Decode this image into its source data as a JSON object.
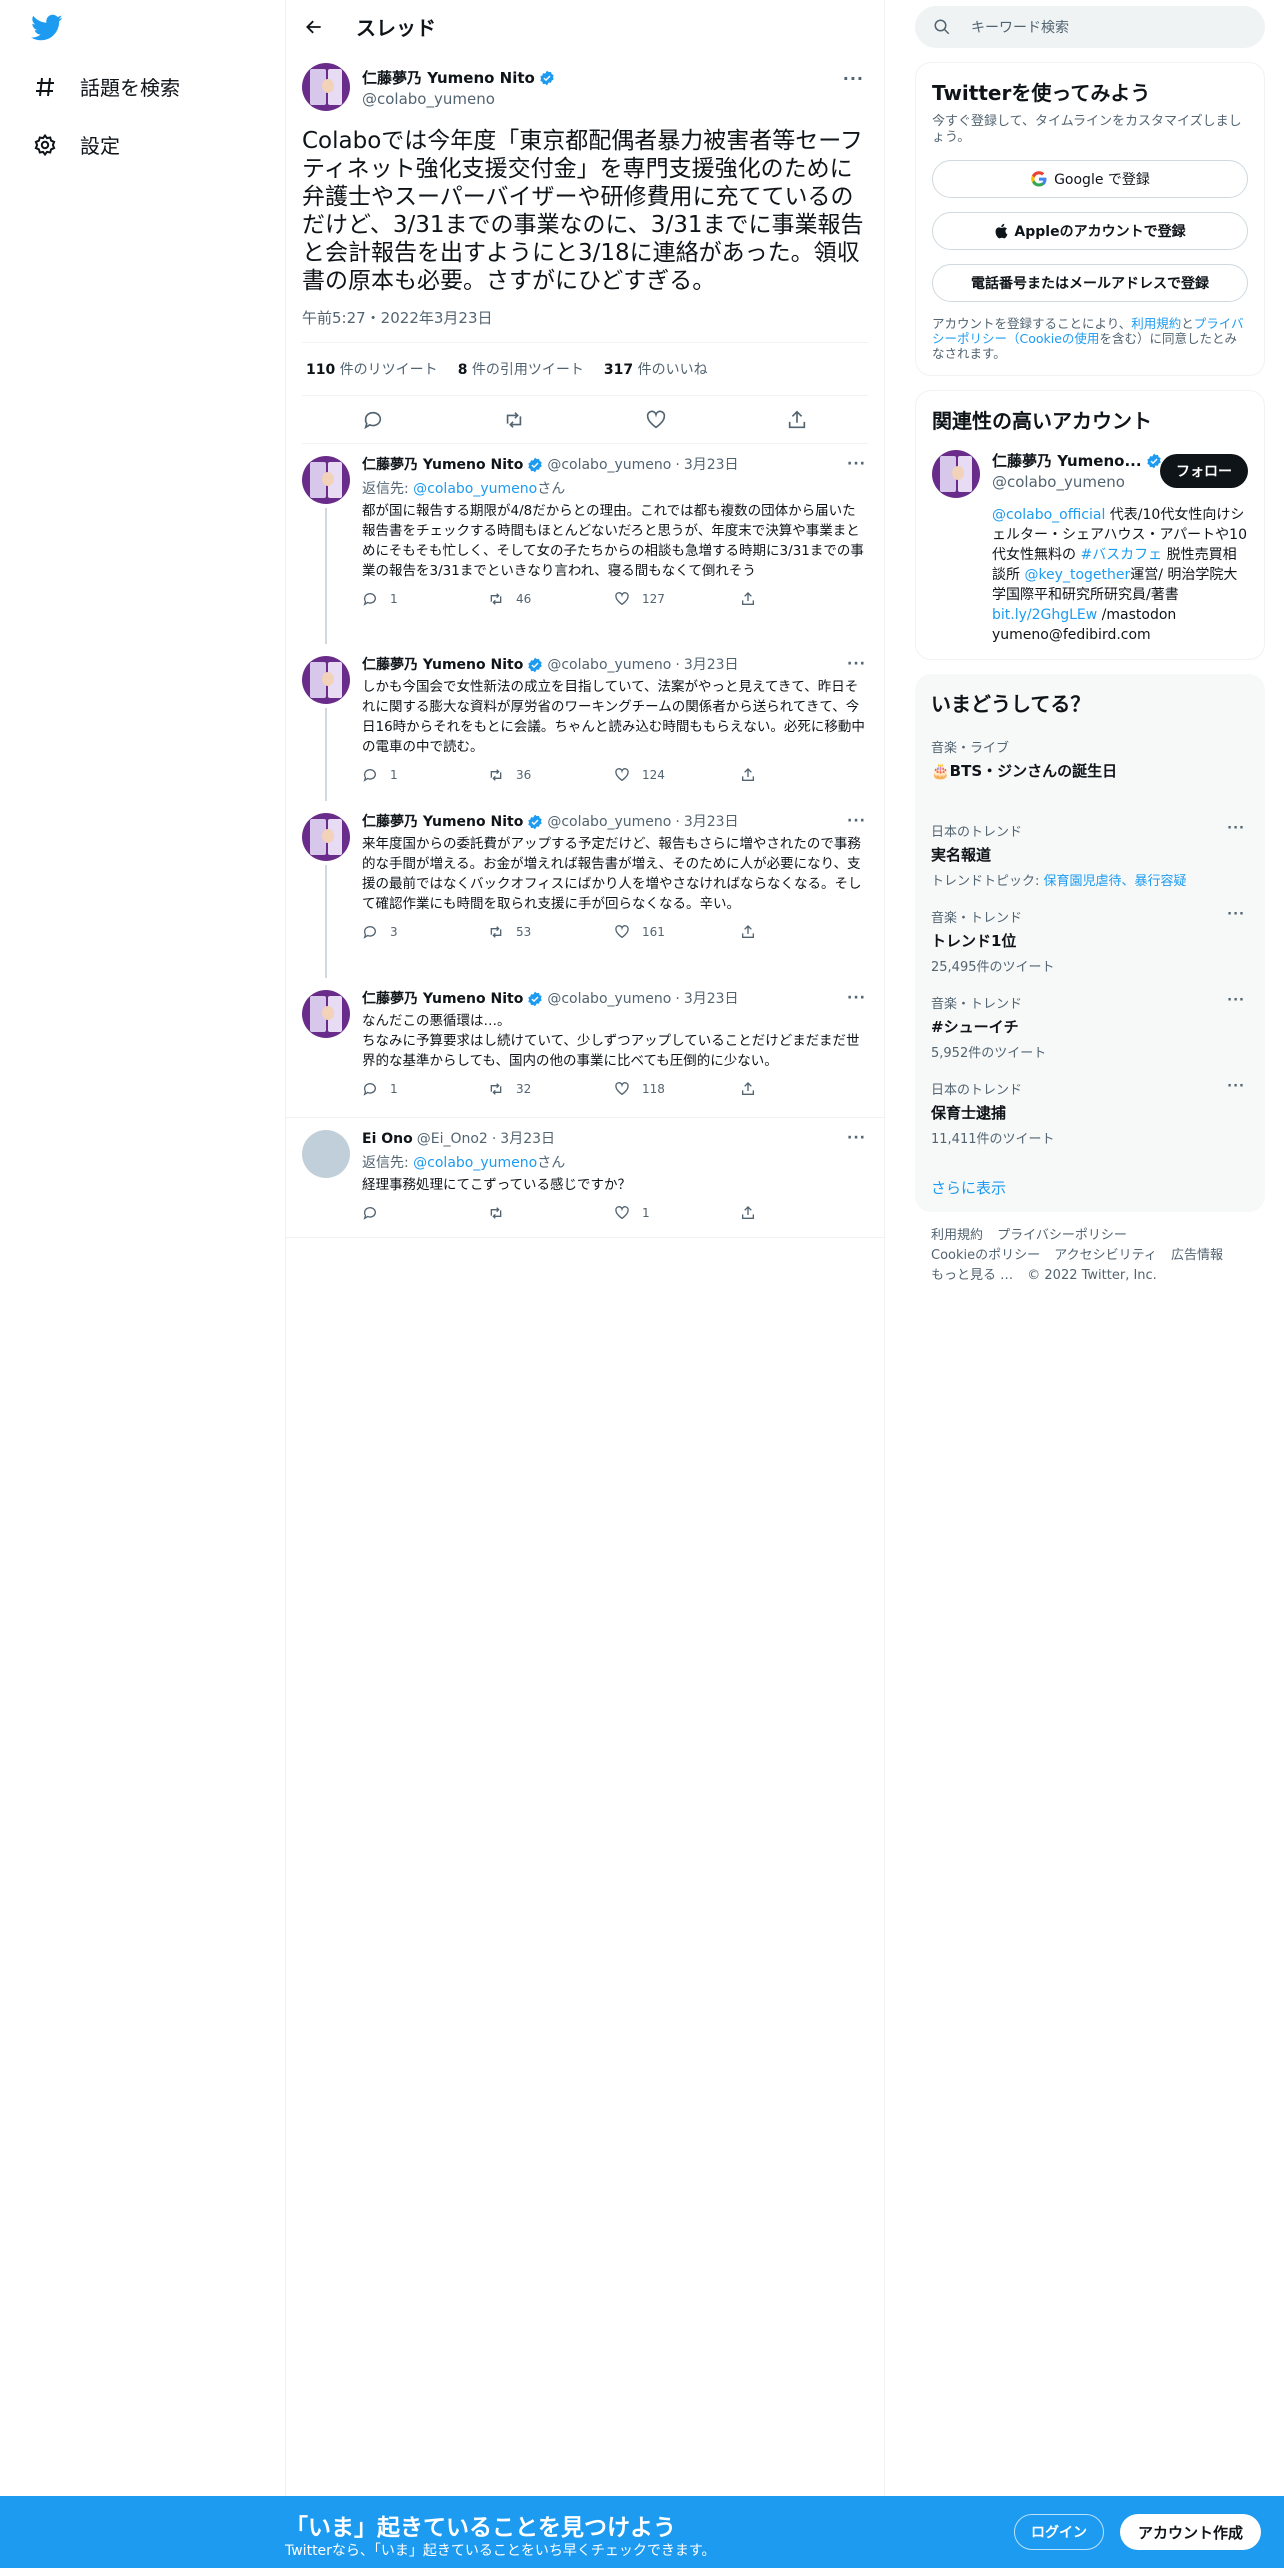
{
  "nav": {
    "items": [
      {
        "label": "話題を検索",
        "icon": "hashtag-icon"
      },
      {
        "label": "設定",
        "icon": "gear-icon"
      }
    ]
  },
  "header": {
    "title": "スレッド"
  },
  "main_tweet": {
    "name": "仁藤夢乃 Yumeno Nito",
    "handle": "@colabo_yumeno",
    "text": "Colaboでは今年度「東京都配偶者暴力被害者等セーフティネット強化支援交付金」を専門支援強化のために弁護士やスーパーバイザーや研修費用に充てているのだけど、3/31までの事業なのに、3/31までに事業報告と会計報告を出すようにと3/18に連絡があった。領収書の原本も必要。さすがにひどすぎる。",
    "time": "午前5:27・2022年3月23日",
    "retweets": "110",
    "retweets_label": "件のリツイート",
    "quotes": "8",
    "quotes_label": "件の引用ツイート",
    "likes": "317",
    "likes_label": "件のいいね"
  },
  "replies": [
    {
      "name": "仁藤夢乃 Yumeno Nito",
      "handle": "@colabo_yumeno",
      "date": "3月23日",
      "replying_prefix": "返信先: ",
      "replying_to": "@colabo_yumeno",
      "replying_suffix": "さん",
      "text": "都が国に報告する期限が4/8だからとの理由。これでは都も複数の団体から届いた報告書をチェックする時間もほとんどないだろと思うが、年度末で決算や事業まとめにそもそも忙しく、そして女の子たちからの相談も急増する時期に3/31までの事業の報告を3/31までといきなり言われ、寝る間もなくて倒れそう",
      "replies": "1",
      "retweets": "46",
      "likes": "127"
    },
    {
      "name": "仁藤夢乃 Yumeno Nito",
      "handle": "@colabo_yumeno",
      "date": "3月23日",
      "text": "しかも今国会で女性新法の成立を目指していて、法案がやっと見えてきて、昨日それに関する膨大な資料が厚労省のワーキングチームの関係者から送られてきて、今日16時からそれをもとに会議。ちゃんと読み込む時間ももらえない。必死に移動中の電車の中で読む。",
      "replies": "1",
      "retweets": "36",
      "likes": "124"
    },
    {
      "name": "仁藤夢乃 Yumeno Nito",
      "handle": "@colabo_yumeno",
      "date": "3月23日",
      "text": "来年度国からの委託費がアップする予定だけど、報告もさらに増やされたので事務的な手間が増える。お金が増えれば報告書が増え、そのために人が必要になり、支援の最前ではなくバックオフィスにばかり人を増やさなければならなくなる。そして確認作業にも時間を取られ支援に手が回らなくなる。辛い。",
      "replies": "3",
      "retweets": "53",
      "likes": "161"
    },
    {
      "name": "仁藤夢乃 Yumeno Nito",
      "handle": "@colabo_yumeno",
      "date": "3月23日",
      "text": "なんだこの悪循環は…。\nちなみに予算要求はし続けていて、少しずつアップしていることだけどまだまだ世界的な基準からしても、国内の他の事業に比べても圧倒的に少ない。",
      "replies": "1",
      "retweets": "32",
      "likes": "118"
    },
    {
      "name": "Ei Ono",
      "handle": "@Ei_Ono2",
      "date": "3月23日",
      "replying_prefix": "返信先: ",
      "replying_to": "@colabo_yumeno",
      "replying_suffix": "さん",
      "text": "経理事務処理にてこずっている感じですか？",
      "replies": "",
      "retweets": "",
      "likes": "1"
    }
  ],
  "search": {
    "placeholder": "キーワード検索"
  },
  "signup": {
    "title": "Twitterを使ってみよう",
    "subtitle": "今すぐ登録して、タイムラインをカスタマイズしましょう。",
    "google": "Google で登録",
    "apple": "Appleのアカウントで登録",
    "phone": "電話番号またはメールアドレスで登録",
    "legal_1": "アカウントを登録することにより、",
    "legal_terms": "利用規約",
    "legal_2": "と",
    "legal_privacy": "プライバシーポリシー（Cookieの使用",
    "legal_3": "を含む）に同意したとみなされます。"
  },
  "related": {
    "title": "関連性の高いアカウント",
    "name": "仁藤夢乃 Yumeno...",
    "handle": "@colabo_yumeno",
    "follow": "フォロー",
    "bio_link1": "@colabo_official",
    "bio_1": " 代表/10代女性向けシェルター・シェアハウス・アパートや10代女性無料の ",
    "bio_link2": "#バスカフェ",
    "bio_2": " 脱性売買相談所 ",
    "bio_link3": "@key_together",
    "bio_3": "運営/ 明治学院大学国際平和研究所研究員/著書",
    "bio_link4": "bit.ly/2GhgLEw",
    "bio_4": " /mastodon yumeno@fedibird.com"
  },
  "trends": {
    "title": "いまどうしてる？",
    "items": [
      {
        "context": "音楽・ライブ",
        "name": "🎂BTS・ジンさんの誕生日",
        "count": ""
      },
      {
        "context": "日本のトレンド",
        "name": "実名報道",
        "count": "",
        "topic_prefix": "トレンドトピック: ",
        "topic": "保育園児虐待、暴行容疑"
      },
      {
        "context": "音楽・トレンド",
        "name": "トレンド1位",
        "count": "25,495件のツイート"
      },
      {
        "context": "音楽・トレンド",
        "name": "#シューイチ",
        "count": "5,952件のツイート"
      },
      {
        "context": "日本のトレンド",
        "name": "保育士逮捕",
        "count": "11,411件のツイート"
      }
    ],
    "show_more": "さらに表示"
  },
  "footer": {
    "links": [
      "利用規約",
      "プライバシーポリシー",
      "Cookieのポリシー",
      "アクセシビリティ",
      "広告情報",
      "もっと見る …"
    ],
    "copyright": "© 2022 Twitter, Inc."
  },
  "bottom_bar": {
    "title": "「いま」起きていることを見つけよう",
    "subtitle": "Twitterなら、「いま」起きていることをいち早くチェックできます。",
    "login": "ログイン",
    "signup": "アカウント作成"
  },
  "colors": {
    "accent": "#1d9bf0",
    "text": "#0f1419",
    "secondary": "#536471"
  }
}
